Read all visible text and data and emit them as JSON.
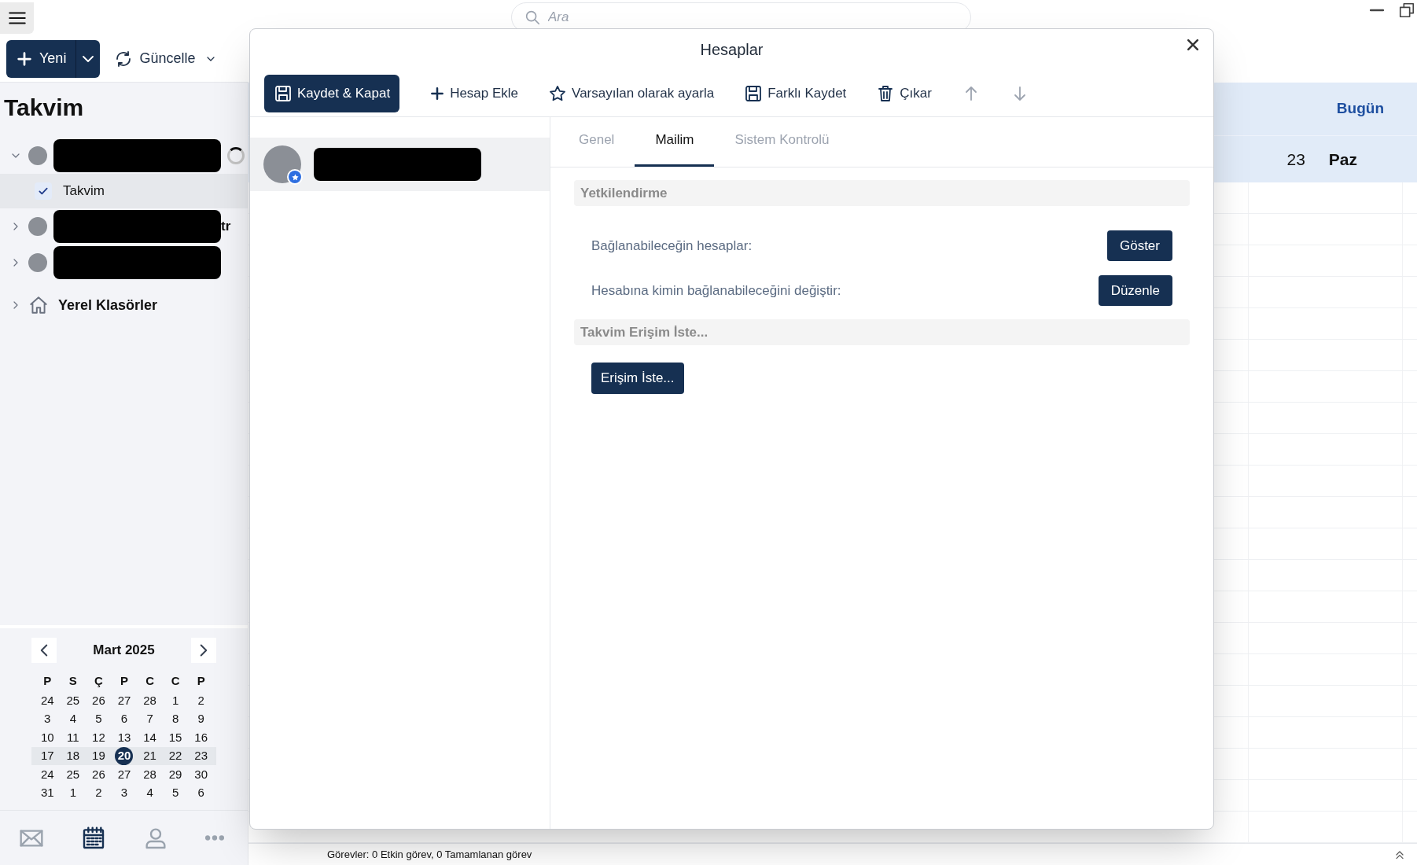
{
  "window": {
    "search": {
      "placeholder": "Ara"
    }
  },
  "toolbar": {
    "new_button": {
      "label": "Yeni"
    },
    "refresh_button": {
      "label": "Güncelle"
    }
  },
  "sidebar": {
    "title": "Takvim",
    "tree": [
      {
        "kind": "account",
        "expanded": true,
        "redacted": true,
        "loading": true,
        "children": [
          {
            "kind": "calendar",
            "label": "Takvim",
            "checked": true,
            "selected": true
          }
        ]
      },
      {
        "kind": "account",
        "expanded": false,
        "redacted": true,
        "loading": false,
        "suffix": "tr"
      },
      {
        "kind": "account",
        "expanded": false,
        "redacted": true,
        "loading": false
      },
      {
        "kind": "folder",
        "expanded": false,
        "label": "Yerel Klasörler"
      }
    ]
  },
  "mini_calendar": {
    "month": "Mart 2025",
    "weekdays": [
      "P",
      "S",
      "Ç",
      "P",
      "C",
      "C",
      "P"
    ],
    "weeks": [
      {
        "current": false,
        "days": [
          {
            "label": "24",
            "selected": false
          },
          {
            "label": "25",
            "selected": false
          },
          {
            "label": "26",
            "selected": false
          },
          {
            "label": "27",
            "selected": false
          },
          {
            "label": "28",
            "selected": false
          },
          {
            "label": "1",
            "selected": false
          },
          {
            "label": "2",
            "selected": false
          }
        ]
      },
      {
        "current": false,
        "days": [
          {
            "label": "3",
            "selected": false
          },
          {
            "label": "4",
            "selected": false
          },
          {
            "label": "5",
            "selected": false
          },
          {
            "label": "6",
            "selected": false
          },
          {
            "label": "7",
            "selected": false
          },
          {
            "label": "8",
            "selected": false
          },
          {
            "label": "9",
            "selected": false
          }
        ]
      },
      {
        "current": false,
        "days": [
          {
            "label": "10",
            "selected": false
          },
          {
            "label": "11",
            "selected": false
          },
          {
            "label": "12",
            "selected": false
          },
          {
            "label": "13",
            "selected": false
          },
          {
            "label": "14",
            "selected": false
          },
          {
            "label": "15",
            "selected": false
          },
          {
            "label": "16",
            "selected": false
          }
        ]
      },
      {
        "current": true,
        "days": [
          {
            "label": "17",
            "selected": false
          },
          {
            "label": "18",
            "selected": false
          },
          {
            "label": "19",
            "selected": false
          },
          {
            "label": "20",
            "selected": true
          },
          {
            "label": "21",
            "selected": false
          },
          {
            "label": "22",
            "selected": false
          },
          {
            "label": "23",
            "selected": false
          }
        ]
      },
      {
        "current": false,
        "days": [
          {
            "label": "24",
            "selected": false
          },
          {
            "label": "25",
            "selected": false
          },
          {
            "label": "26",
            "selected": false
          },
          {
            "label": "27",
            "selected": false
          },
          {
            "label": "28",
            "selected": false
          },
          {
            "label": "29",
            "selected": false
          },
          {
            "label": "30",
            "selected": false
          }
        ]
      },
      {
        "current": false,
        "days": [
          {
            "label": "31",
            "selected": false
          },
          {
            "label": "1",
            "selected": false
          },
          {
            "label": "2",
            "selected": false
          },
          {
            "label": "3",
            "selected": false
          },
          {
            "label": "4",
            "selected": false
          },
          {
            "label": "5",
            "selected": false
          },
          {
            "label": "6",
            "selected": false
          }
        ]
      }
    ]
  },
  "bottom_nav": [
    {
      "kind": "mail",
      "selected": false
    },
    {
      "kind": "calendar",
      "selected": true
    },
    {
      "kind": "contacts",
      "selected": false
    },
    {
      "kind": "more",
      "selected": false
    }
  ],
  "calendar_view": {
    "today_label": "Bugün",
    "day_number": "23",
    "day_name": "Paz"
  },
  "status_bar": {
    "text": "Görevler: 0 Etkin görev, 0 Tamamlanan görev"
  },
  "dialog": {
    "title": "Hesaplar",
    "toolbar": [
      {
        "kind": "save-close",
        "label": "Kaydet & Kapat",
        "primary": true,
        "disabled": false
      },
      {
        "kind": "add",
        "label": "Hesap Ekle",
        "primary": false,
        "disabled": false
      },
      {
        "kind": "star",
        "label": "Varsayılan olarak ayarla",
        "primary": false,
        "disabled": false
      },
      {
        "kind": "save-as",
        "label": "Farklı Kaydet",
        "primary": false,
        "disabled": false
      },
      {
        "kind": "delete",
        "label": "Çıkar",
        "primary": false,
        "disabled": false
      },
      {
        "kind": "up",
        "primary": false,
        "disabled": true
      },
      {
        "kind": "down",
        "primary": false,
        "disabled": true
      }
    ],
    "accounts": [
      {
        "redacted": true,
        "default": true,
        "selected": true
      }
    ],
    "tabs": [
      {
        "label": "Genel",
        "selected": false
      },
      {
        "label": "Mailim",
        "selected": true
      },
      {
        "label": "Sistem Kontrolü",
        "selected": false
      }
    ],
    "sections": [
      {
        "title": "Yetkilendirme",
        "rows": [
          {
            "label": "Bağlanabileceğin hesaplar:",
            "button": "Göster"
          },
          {
            "label": "Hesabına kimin bağlanabileceğini değiştir:",
            "button": "Düzenle"
          }
        ]
      },
      {
        "title": "Takvim Erişim İste...",
        "buttons": [
          "Erişim İste..."
        ]
      }
    ]
  }
}
